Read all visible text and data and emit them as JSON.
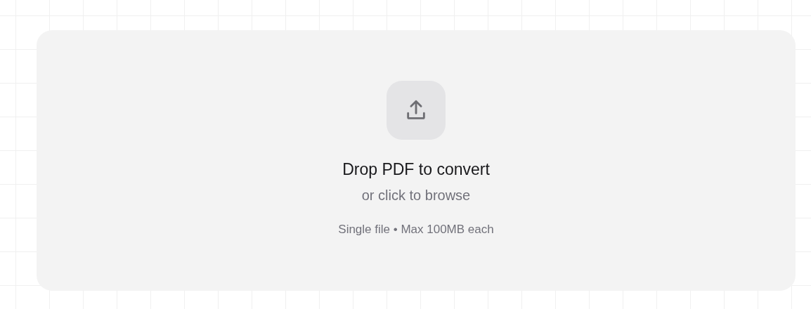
{
  "dropzone": {
    "title": "Drop PDF to convert",
    "subtitle": "or click to browse",
    "hint": "Single file • Max 100MB each"
  }
}
